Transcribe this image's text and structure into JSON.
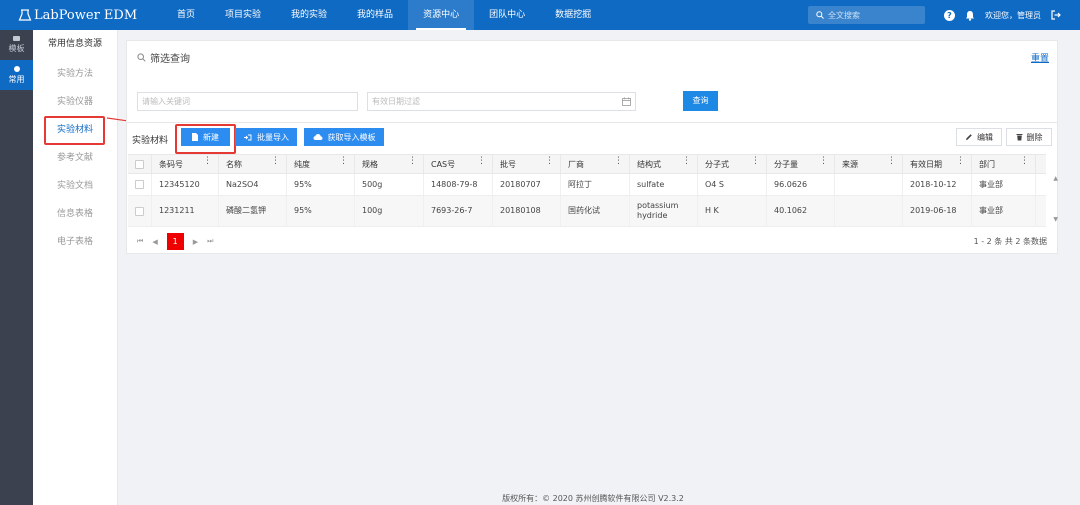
{
  "app": {
    "logo_text": "LabPower EDM"
  },
  "nav": [
    {
      "label": "首页"
    },
    {
      "label": "项目实验"
    },
    {
      "label": "我的实验"
    },
    {
      "label": "我的样品"
    },
    {
      "label": "资源中心"
    },
    {
      "label": "团队中心"
    },
    {
      "label": "数据挖掘"
    }
  ],
  "topbar": {
    "search_placeholder": "全文搜索",
    "help_glyph": "?",
    "welcome": "欢迎您，管理员"
  },
  "rail": [
    {
      "label": "模板"
    },
    {
      "label": "常用"
    }
  ],
  "submenu": {
    "title": "常用信息资源",
    "items": [
      {
        "label": "实验方法"
      },
      {
        "label": "实验仪器"
      },
      {
        "label": "实验材料"
      },
      {
        "label": "参考文献"
      },
      {
        "label": "实验文档"
      },
      {
        "label": "信息表格"
      },
      {
        "label": "电子表格"
      }
    ]
  },
  "filter": {
    "title": "筛选查询",
    "reset": "重置",
    "keyword_placeholder": "请输入关键词",
    "date_placeholder": "有效日期过滤",
    "query": "查询"
  },
  "toolbar": {
    "panel_title": "实验材料",
    "new": "新建",
    "batch_import": "批量导入",
    "get_template": "获取导入模板",
    "edit": "编辑",
    "delete": "删除"
  },
  "table": {
    "columns": [
      "条码号",
      "名称",
      "纯度",
      "规格",
      "CAS号",
      "批号",
      "厂商",
      "结构式",
      "分子式",
      "分子量",
      "来源",
      "有效日期",
      "部门"
    ],
    "rows": [
      [
        "12345120",
        "Na2SO4",
        "95%",
        "500g",
        "14808-79-8",
        "20180707",
        "阿拉丁",
        "sulfate",
        "O4 S",
        "96.0626",
        "",
        "2018-10-12",
        "事业部"
      ],
      [
        "1231211",
        "磷酸二氢钾",
        "95%",
        "100g",
        "7693-26-7",
        "20180108",
        "国药化试",
        "potassium hydride",
        "H K",
        "40.1062",
        "",
        "2019-06-18",
        "事业部"
      ]
    ]
  },
  "pager": {
    "current": "1",
    "info": "1 - 2 条   共 2 条数据"
  },
  "footer": {
    "text": "版权所有：© 2020 苏州创腾软件有限公司   V2.3.2"
  },
  "colors": {
    "topbar": "#0f6ac4",
    "accent": "#2d8cf0",
    "highlight": "#e53935",
    "pager_current": "#ee0000"
  }
}
